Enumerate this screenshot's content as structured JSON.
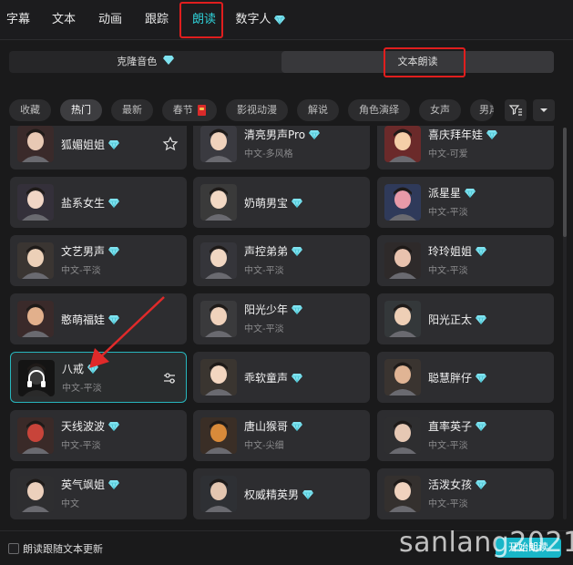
{
  "top_tabs": [
    {
      "label": "字幕"
    },
    {
      "label": "文本"
    },
    {
      "label": "动画"
    },
    {
      "label": "跟踪"
    },
    {
      "label": "朗读",
      "active": true
    },
    {
      "label": "数字人",
      "premium": true
    }
  ],
  "segments": [
    {
      "label": "克隆音色",
      "premium": true
    },
    {
      "label": "文本朗读",
      "active": true
    }
  ],
  "filters": [
    "收藏",
    "热门",
    "最新",
    "春节",
    "影视动漫",
    "解说",
    "角色演绎",
    "女声",
    "男声"
  ],
  "active_filter": "热门",
  "voices": [
    {
      "name": "狐媚姐姐",
      "sub": "",
      "action": "star-icon"
    },
    {
      "name": "清亮男声Pro",
      "sub": "中文-多风格"
    },
    {
      "name": "喜庆拜年娃",
      "sub": "中文-可爱"
    },
    {
      "name": "盐系女生",
      "sub": ""
    },
    {
      "name": "奶萌男宝",
      "sub": ""
    },
    {
      "name": "派星星",
      "sub": "中文-平淡"
    },
    {
      "name": "文艺男声",
      "sub": "中文-平淡"
    },
    {
      "name": "声控弟弟",
      "sub": "中文-平淡"
    },
    {
      "name": "玲玲姐姐",
      "sub": "中文-平淡"
    },
    {
      "name": "憨萌福娃",
      "sub": ""
    },
    {
      "name": "阳光少年",
      "sub": "中文-平淡"
    },
    {
      "name": "阳光正太",
      "sub": ""
    },
    {
      "name": "八戒",
      "sub": "中文-平淡",
      "selected": true,
      "action": "settings-sliders-icon"
    },
    {
      "name": "乖软童声",
      "sub": ""
    },
    {
      "name": "聪慧胖仔",
      "sub": ""
    },
    {
      "name": "天线波波",
      "sub": "中文-平淡"
    },
    {
      "name": "唐山猴哥",
      "sub": "中文-尖细"
    },
    {
      "name": "直率英子",
      "sub": "中文-平淡"
    },
    {
      "name": "英气飒姐",
      "sub": "中文"
    },
    {
      "name": "权威精英男",
      "sub": ""
    },
    {
      "name": "活泼女孩",
      "sub": "中文-平淡"
    }
  ],
  "bottom": {
    "follow_text": "朗读跟随文本更新",
    "start_button": "开始朗读",
    "watermark": "sanlang2021"
  },
  "colors": {
    "accent": "#2fd0d8",
    "highlight_box": "#e01e1e",
    "arrow": "#e02a2a",
    "selected_border": "#27b6bd",
    "diamond": "#7fe3f0"
  }
}
